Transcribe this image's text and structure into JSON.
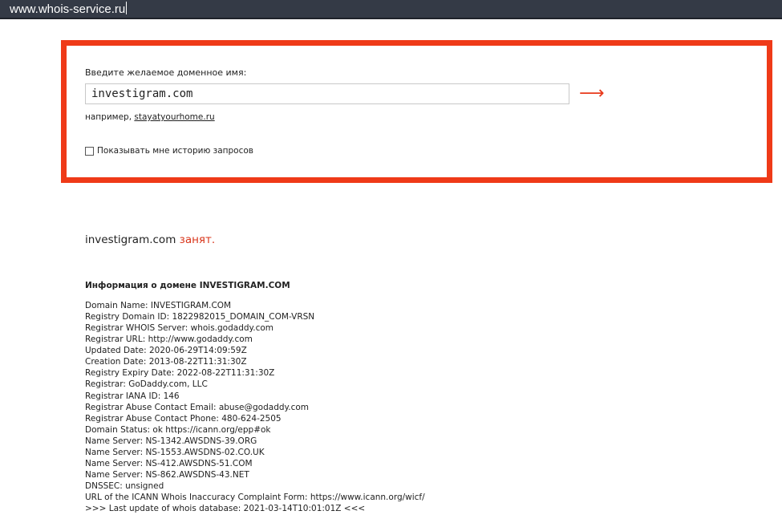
{
  "browser": {
    "url": "www.whois-service.ru"
  },
  "form": {
    "prompt": "Введите желаемое доменное имя:",
    "domain_value": "investigram.com",
    "submit_icon": "right-arrow-icon",
    "submit_symbol": "⟶",
    "example_prefix": "например,",
    "example_link": "stayatyourhome.ru",
    "history_label": "Показывать мне историю запросов",
    "history_checked": false
  },
  "result": {
    "domain": "investigram.com",
    "status": "занят."
  },
  "info": {
    "heading": "Информация о домене INVESTIGRAM.COM",
    "lines": [
      "Domain Name: INVESTIGRAM.COM",
      "Registry Domain ID: 1822982015_DOMAIN_COM-VRSN",
      "Registrar WHOIS Server: whois.godaddy.com",
      "Registrar URL: http://www.godaddy.com",
      "Updated Date: 2020-06-29T14:09:59Z",
      "Creation Date: 2013-08-22T11:31:30Z",
      "Registry Expiry Date: 2022-08-22T11:31:30Z",
      "Registrar: GoDaddy.com, LLC",
      "Registrar IANA ID: 146",
      "Registrar Abuse Contact Email: abuse@godaddy.com",
      "Registrar Abuse Contact Phone: 480-624-2505",
      "Domain Status: ok https://icann.org/epp#ok",
      "Name Server: NS-1342.AWSDNS-39.ORG",
      "Name Server: NS-1553.AWSDNS-02.CO.UK",
      "Name Server: NS-412.AWSDNS-51.COM",
      "Name Server: NS-862.AWSDNS-43.NET",
      "DNSSEC: unsigned",
      "URL of the ICANN Whois Inaccuracy Complaint Form: https://www.icann.org/wicf/",
      ">>> Last update of whois database: 2021-03-14T10:01:01Z <<<"
    ]
  },
  "colors": {
    "highlight_border": "#ef3a18",
    "taken_status": "#d9351a",
    "url_bar": "#343a46"
  }
}
